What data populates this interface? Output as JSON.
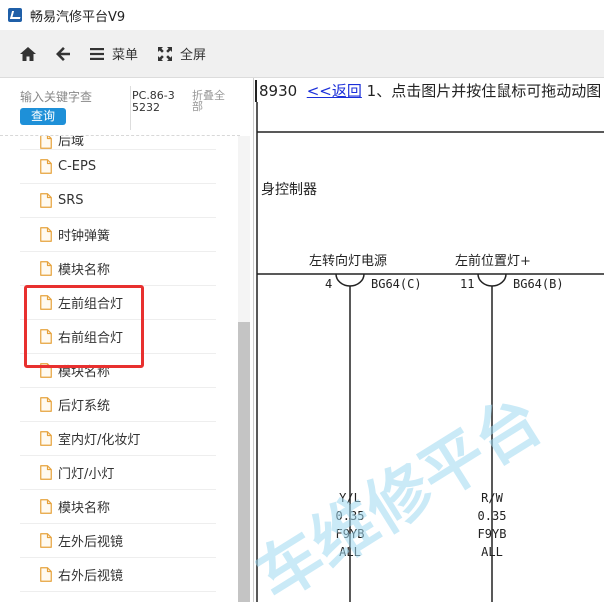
{
  "window": {
    "title": "畅易汽修平台V9"
  },
  "toolbar": {
    "home_icon": "home-icon",
    "back_icon": "arrow-left-icon",
    "menu_label": "菜单",
    "fullscreen_label": "全屏"
  },
  "sidebar": {
    "search_placeholder": "输入关键字查",
    "query_label": "查询",
    "pc_code": "PC.86-35232",
    "collapse_label": "折叠全部",
    "items": [
      {
        "label": "后域"
      },
      {
        "label": "C-EPS"
      },
      {
        "label": "SRS"
      },
      {
        "label": "时钟弹簧"
      },
      {
        "label": "模块名称"
      },
      {
        "label": "左前组合灯"
      },
      {
        "label": "右前组合灯"
      },
      {
        "label": "模块名称"
      },
      {
        "label": "后灯系统"
      },
      {
        "label": "室内灯/化妆灯"
      },
      {
        "label": "门灯/小灯"
      },
      {
        "label": "模块名称"
      },
      {
        "label": "左外后视镜"
      },
      {
        "label": "右外后视镜"
      }
    ]
  },
  "main": {
    "code_prefix": "8930",
    "back_link": "<<返回",
    "instruction": "1、点击图片并按住鼠标可拖动动图",
    "diagram": {
      "module_label": "身控制器",
      "connector1": {
        "title": "左转向灯电源",
        "pin": "4",
        "connector": "BG64(C)",
        "wire_color": "Y/L",
        "wire_size": "0.35",
        "harness": "F9YB",
        "option": "ALL"
      },
      "connector2": {
        "title": "左前位置灯+",
        "pin": "11",
        "connector": "BG64(B)",
        "wire_color": "R/W",
        "wire_size": "0.35",
        "harness": "F9YB",
        "option": "ALL"
      }
    },
    "watermark": "车维修平台"
  },
  "colors": {
    "accent": "#1e90d8",
    "highlight": "#e8302f",
    "link": "#1b2fd9",
    "watermark": "#9fd9f0"
  }
}
